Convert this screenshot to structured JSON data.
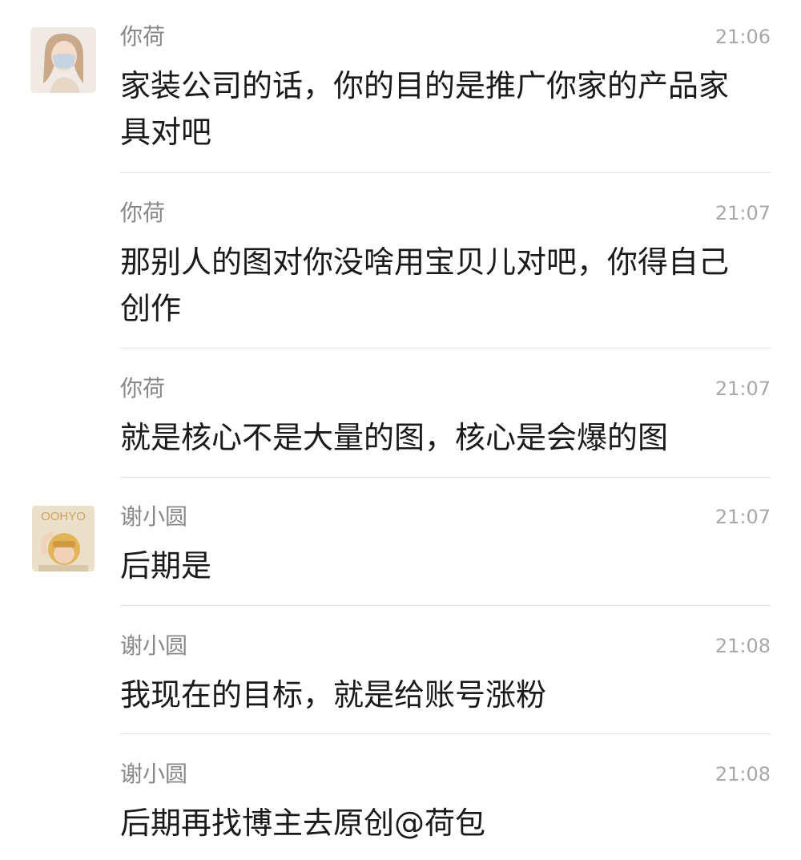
{
  "messages": [
    {
      "sender": "你荷",
      "time": "21:06",
      "text": "家装公司的话，你的目的是推广你家的产品家具对吧",
      "avatar": "avatar-nihe"
    },
    {
      "sender": "你荷",
      "time": "21:07",
      "text": "那别人的图对你没啥用宝贝儿对吧，你得自己创作"
    },
    {
      "sender": "你荷",
      "time": "21:07",
      "text": "就是核心不是大量的图，核心是会爆的图"
    },
    {
      "sender": "谢小圆",
      "time": "21:07",
      "text": "后期是",
      "avatar": "avatar-xiexiaoyuan"
    },
    {
      "sender": "谢小圆",
      "time": "21:08",
      "text": "我现在的目标，就是给账号涨粉"
    },
    {
      "sender": "谢小圆",
      "time": "21:08",
      "text": "后期再找博主去原创@荷包"
    }
  ],
  "avatars": {
    "xiexiaoyuan_label": "OOHYO"
  },
  "colors": {
    "sender": "#888888",
    "time": "#a8a8a8",
    "text": "#1a1a1a",
    "divider": "#e3e3e3"
  }
}
